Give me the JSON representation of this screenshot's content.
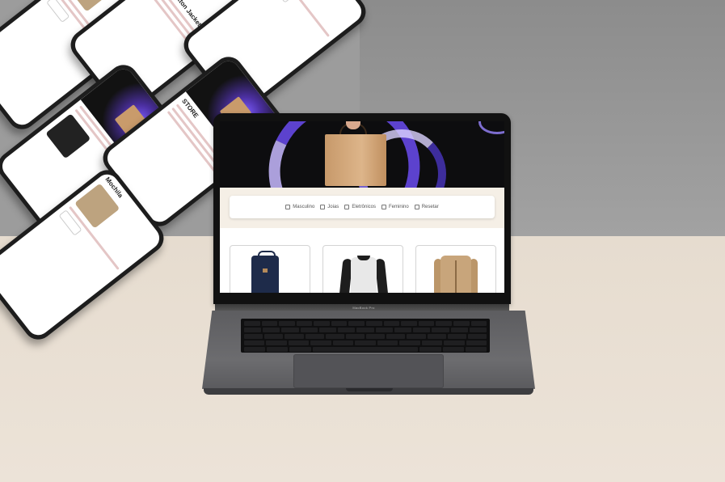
{
  "filters": {
    "items": [
      "Masculino",
      "Joias",
      "Eletrônicos",
      "Feminino",
      "Resetar"
    ]
  },
  "laptop": {
    "brand": "MacBook Pro"
  },
  "phones": {
    "title_1": "Mens Cotton Jacket",
    "title_2": "Mochila",
    "title_3": "STORE"
  },
  "icons": [
    "shopping-bag-icon",
    "checkbox-icon"
  ],
  "colors": {
    "hero_bg": "#0d0d0f",
    "accent_purple": "#6a4cf0",
    "filter_area_bg": "#f5efe6"
  }
}
